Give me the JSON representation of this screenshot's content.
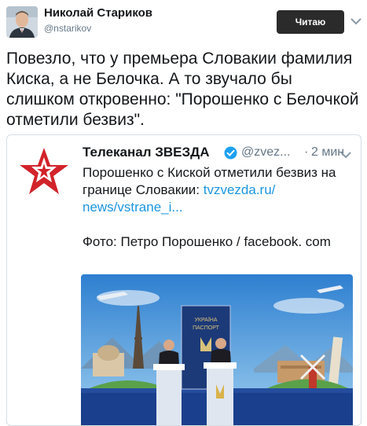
{
  "header": {
    "author_name": "Николай Стариков",
    "author_handle": "@nstarikov",
    "follow_label": "Читаю"
  },
  "tweet": {
    "text": "Повезло, что у премьера Словакии фамилия Киска, а не Белочка. А то звучало бы слишком откровенно: \"Порошенко с Белочкой отметили безвиз\"."
  },
  "quote": {
    "account_name": "Телеканал ЗВЕЗДА",
    "account_handle": "@zvez...",
    "dot": "·",
    "time": "2 мин",
    "body_text": "Порошенко с Киской отметили безвиз на границе Словакии: ",
    "link_text": "tvzvezda.ru/ news/vstrane_i...",
    "caption": "Фото: Петро Порошенко / facebook. com",
    "photo": {
      "banner_text_1": "УКРАЇНА",
      "banner_text_2": "ПАСПОРТ"
    }
  },
  "colors": {
    "link": "#1b95e0",
    "follow_button": "#2b2b2b",
    "zvezda_red": "#d2232a",
    "stage_blue": "#1a3f8c"
  },
  "icons": {
    "verified": "verified-badge-icon",
    "menu": "chevron-down-icon"
  }
}
